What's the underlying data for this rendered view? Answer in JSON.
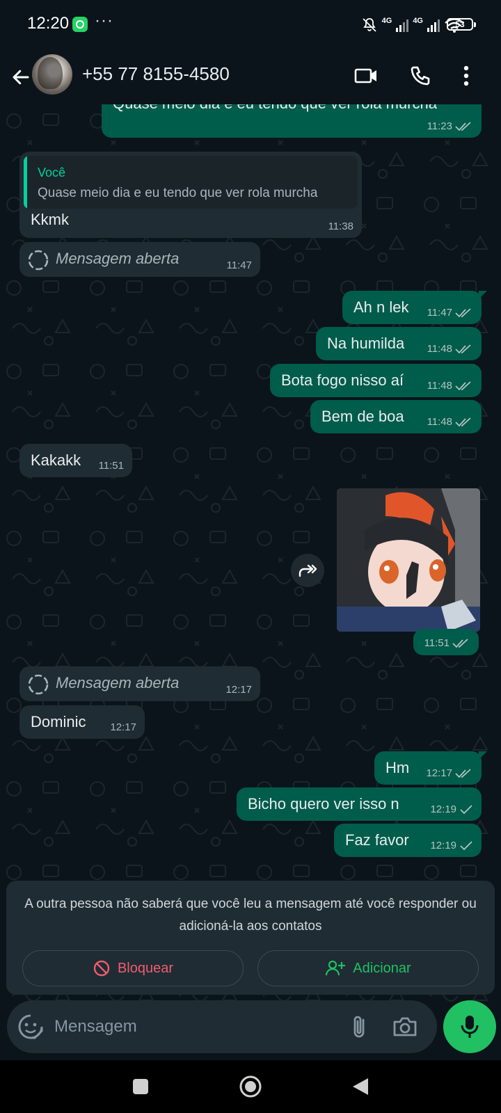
{
  "status_bar": {
    "time": "12:20",
    "more": "···",
    "network_1": "4G",
    "network_2": "4G",
    "battery": "53"
  },
  "header": {
    "contact_name": "+55 77 8155-4580"
  },
  "messages": [
    {
      "direction": "out",
      "text": "Quase meio dia e eu tendo que ver rola murcha",
      "time": "11:23",
      "status": "read"
    },
    {
      "direction": "in",
      "quote_author": "Você",
      "quote_text": "Quase meio dia e eu tendo que ver rola murcha",
      "text": "Kkmk",
      "time": "11:38"
    },
    {
      "direction": "in",
      "type": "view_once",
      "text": "Mensagem aberta",
      "time": "11:47"
    },
    {
      "direction": "out",
      "text": "Ah n lek",
      "time": "11:47",
      "status": "read"
    },
    {
      "direction": "out",
      "text": "Na humilda",
      "time": "11:48",
      "status": "read"
    },
    {
      "direction": "out",
      "text": "Bota fogo nisso aí",
      "time": "11:48",
      "status": "read"
    },
    {
      "direction": "out",
      "text": "Bem de boa",
      "time": "11:48",
      "status": "read"
    },
    {
      "direction": "in",
      "text": "Kakakk",
      "time": "11:51"
    },
    {
      "direction": "out",
      "type": "image",
      "time": "11:51",
      "status": "read"
    },
    {
      "direction": "in",
      "type": "view_once",
      "text": "Mensagem aberta",
      "time": "12:17"
    },
    {
      "direction": "in",
      "text": "Dominic",
      "time": "12:17"
    },
    {
      "direction": "out",
      "text": "Hm",
      "time": "12:17",
      "status": "read"
    },
    {
      "direction": "out",
      "text": "Bicho quero ver isso n",
      "time": "12:19",
      "status": "delivered"
    },
    {
      "direction": "out",
      "text": "Faz favor",
      "time": "12:19",
      "status": "delivered"
    }
  ],
  "warning": {
    "text": "A outra pessoa não saberá que você leu a mensagem até você responder ou adicioná-la aos contatos",
    "block_label": "Bloquear",
    "add_label": "Adicionar"
  },
  "input": {
    "placeholder": "Mensagem"
  },
  "colors": {
    "outgoing_bubble": "#005c4b",
    "incoming_bubble": "#202c33",
    "accent_green": "#21c063",
    "danger_red": "#f15c6d",
    "background": "#0b141a"
  },
  "icons": {
    "back": "arrow-left-icon",
    "video": "video-camera-icon",
    "call": "phone-icon",
    "menu": "more-vertical-icon",
    "read": "double-check-icon",
    "delivered": "single-check-icon",
    "view_once": "view-once-icon",
    "forward": "forward-icon",
    "block": "block-icon",
    "add": "add-contact-icon",
    "emoji": "sticker-icon",
    "attach": "paperclip-icon",
    "camera": "camera-icon",
    "mic": "microphone-icon"
  }
}
